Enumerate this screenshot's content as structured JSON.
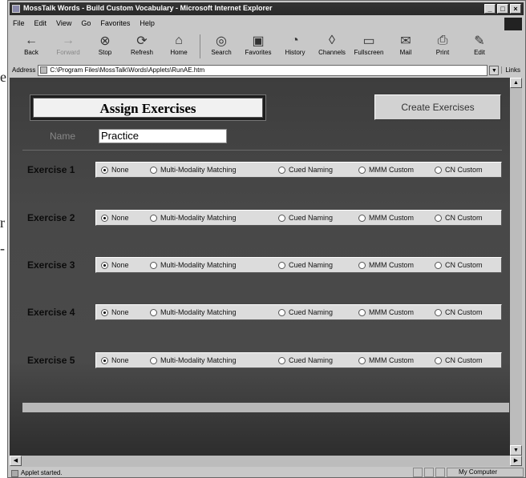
{
  "window": {
    "title": "MossTalk Words - Build Custom Vocabulary - Microsoft Internet Explorer"
  },
  "menu": [
    "File",
    "Edit",
    "View",
    "Go",
    "Favorites",
    "Help"
  ],
  "toolbar": [
    {
      "label": "Back",
      "icon": "back-arrow-icon"
    },
    {
      "label": "Forward",
      "icon": "forward-arrow-icon",
      "disabled": true
    },
    {
      "label": "Stop",
      "icon": "stop-icon"
    },
    {
      "label": "Refresh",
      "icon": "refresh-icon"
    },
    {
      "label": "Home",
      "icon": "home-icon"
    },
    {
      "label": "Search",
      "icon": "search-icon"
    },
    {
      "label": "Favorites",
      "icon": "favorites-icon"
    },
    {
      "label": "History",
      "icon": "history-icon"
    },
    {
      "label": "Channels",
      "icon": "channels-icon"
    },
    {
      "label": "Fullscreen",
      "icon": "fullscreen-icon"
    },
    {
      "label": "Mail",
      "icon": "mail-icon"
    },
    {
      "label": "Print",
      "icon": "print-icon"
    },
    {
      "label": "Edit",
      "icon": "edit-icon"
    }
  ],
  "address": {
    "label": "Address",
    "value": "C:\\Program Files\\MossTalk\\Words\\Applets\\RunAE.htm",
    "links": "Links"
  },
  "page": {
    "title": "Assign Exercises",
    "create_button": "Create Exercises",
    "name_label": "Name",
    "name_value": "Practice",
    "options": [
      "None",
      "Multi-Modality Matching",
      "Cued Naming",
      "MMM Custom",
      "CN Custom"
    ],
    "exercises": [
      {
        "label": "Exercise 1",
        "selected": "None"
      },
      {
        "label": "Exercise 2",
        "selected": "None"
      },
      {
        "label": "Exercise 3",
        "selected": "None"
      },
      {
        "label": "Exercise 4",
        "selected": "None"
      },
      {
        "label": "Exercise 5",
        "selected": "None"
      }
    ]
  },
  "status": {
    "text": "Applet started.",
    "zone": "My Computer"
  },
  "margin_text": [
    "e",
    "r",
    "-"
  ]
}
